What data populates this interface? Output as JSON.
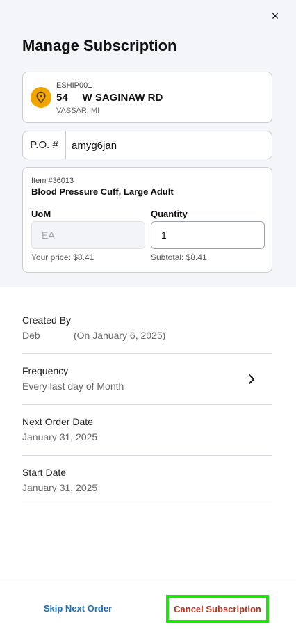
{
  "header": {
    "close_icon": "×",
    "title": "Manage Subscription"
  },
  "address": {
    "code": "ESHIP001",
    "street": "54     W SAGINAW RD",
    "city": "VASSAR, MI",
    "pin_color": "#f0a500"
  },
  "po": {
    "label": "P.O. #",
    "value": "amyg6jan"
  },
  "item": {
    "number": "Item #36013",
    "name": "Blood Pressure Cuff, Large Adult",
    "uom_label": "UoM",
    "uom_placeholder": "EA",
    "quantity_label": "Quantity",
    "quantity_value": "1",
    "price": "Your price: $8.41",
    "subtotal": "Subtotal: $8.41"
  },
  "details": {
    "created_by_label": "Created By",
    "created_by_name": "Deb",
    "created_on": "(On January 6, 2025)",
    "frequency_label": "Frequency",
    "frequency_value": "Every last day of Month",
    "next_order_label": "Next Order Date",
    "next_order_value": "January 31, 2025",
    "start_label": "Start Date",
    "start_value": "January 31, 2025"
  },
  "footer": {
    "skip_label": "Skip Next Order",
    "cancel_label": "Cancel Subscription",
    "skip_color": "#1a6fb6",
    "cancel_color": "#c0321b",
    "highlight_color": "#22e012"
  }
}
